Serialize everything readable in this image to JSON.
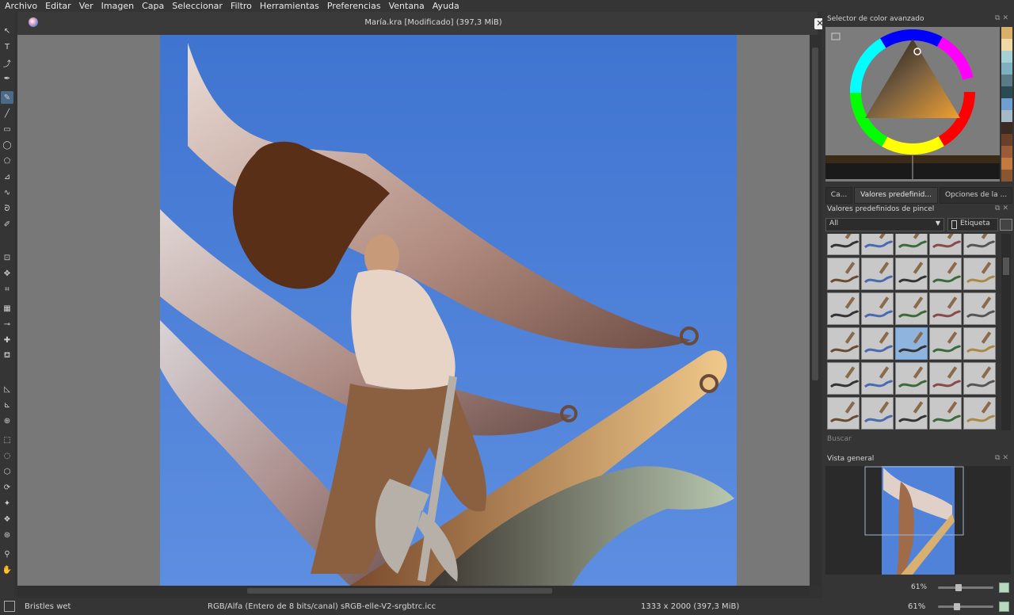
{
  "menu": [
    "Archivo",
    "Editar",
    "Ver",
    "Imagen",
    "Capa",
    "Seleccionar",
    "Filtro",
    "Herramientas",
    "Preferencias",
    "Ventana",
    "Ayuda"
  ],
  "document": {
    "title": "María.kra [Modificado]  (397,3 MiB)"
  },
  "status": {
    "brush_name": "Bristles wet",
    "color_model": "RGB/Alfa (Entero de 8 bits/canal)  sRGB-elle-V2-srgbtrc.icc",
    "dimensions": "1333 x 2000 (397,3 MiB)",
    "zoom": "61%"
  },
  "dock": {
    "color_selector_title": "Selector de color avanzado",
    "tabs": [
      "Ca...",
      "Valores predefinid...",
      "Opciones de la ..."
    ],
    "presets_title": "Valores predefinidos de pincel",
    "filter_value": "All",
    "tag_label": "Etiqueta",
    "search_placeholder": "Buscar",
    "overview_title": "Vista general",
    "overview_zoom": "61%"
  },
  "swatches": [
    "#d8b06a",
    "#f1d9a6",
    "#a7cfd6",
    "#7fb0c0",
    "#5a7a86",
    "#2a4a54",
    "#6e9fd0",
    "#a6b9c7",
    "#3a2a22",
    "#6a3e28",
    "#9a5b36",
    "#c27a3e",
    "#8a5630"
  ],
  "tools": [
    "select-shapes-icon",
    "text-icon",
    "edit-shapes-icon",
    "calligraphy-icon",
    "freehand-brush-icon",
    "line-icon",
    "rectangle-icon",
    "ellipse-icon",
    "polygon-icon",
    "polyline-icon",
    "bezier-icon",
    "freehand-path-icon",
    "dynamic-brush-icon",
    "transform-icon",
    "move-icon",
    "crop-icon",
    "gradient-icon",
    "color-picker-icon",
    "smart-patch-icon",
    "fill-icon",
    "assistant-icon",
    "measure-icon",
    "reference-icon",
    "rect-select-icon",
    "ellipse-select-icon",
    "polygon-select-icon",
    "freehand-select-icon",
    "contiguous-select-icon",
    "similar-select-icon",
    "bezier-select-icon",
    "zoom-icon",
    "pan-icon"
  ]
}
